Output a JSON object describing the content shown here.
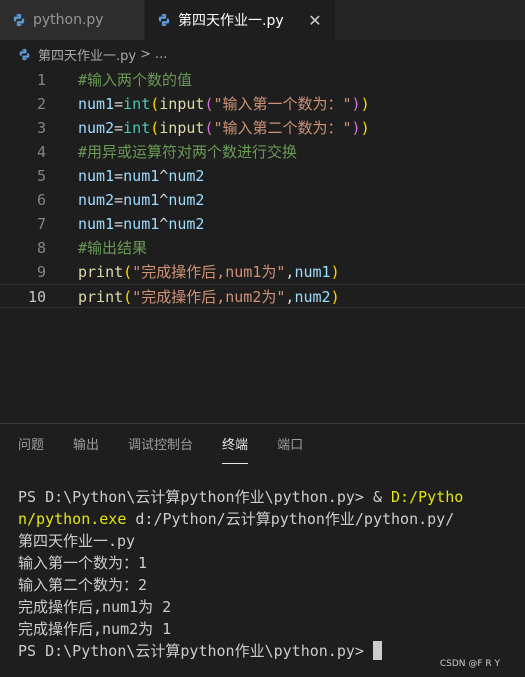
{
  "tabs": [
    {
      "label": "python.py",
      "active": false
    },
    {
      "label": "第四天作业一.py",
      "active": true
    }
  ],
  "close_icon_glyph": "✕",
  "breadcrumb": {
    "file": "第四天作业一.py",
    "sep": ">",
    "more": "..."
  },
  "editor": {
    "line_numbers": [
      "1",
      "2",
      "3",
      "4",
      "5",
      "6",
      "7",
      "8",
      "9",
      "10"
    ],
    "current_line": 10,
    "lines": [
      [
        {
          "t": "#输入两个数的值",
          "c": "cm"
        }
      ],
      [
        {
          "t": "num1",
          "c": "vr"
        },
        {
          "t": "=",
          "c": "op"
        },
        {
          "t": "int",
          "c": "ty"
        },
        {
          "t": "(",
          "c": "p1"
        },
        {
          "t": "input",
          "c": "fn"
        },
        {
          "t": "(",
          "c": "p2"
        },
        {
          "t": "\"输入第一个数为：\"",
          "c": "st"
        },
        {
          "t": ")",
          "c": "p2"
        },
        {
          "t": ")",
          "c": "p1"
        }
      ],
      [
        {
          "t": "num2",
          "c": "vr"
        },
        {
          "t": "=",
          "c": "op"
        },
        {
          "t": "int",
          "c": "ty"
        },
        {
          "t": "(",
          "c": "p1"
        },
        {
          "t": "input",
          "c": "fn"
        },
        {
          "t": "(",
          "c": "p2"
        },
        {
          "t": "\"输入第二个数为：\"",
          "c": "st"
        },
        {
          "t": ")",
          "c": "p2"
        },
        {
          "t": ")",
          "c": "p1"
        }
      ],
      [
        {
          "t": "#用异或运算符对两个数进行交换",
          "c": "cm"
        }
      ],
      [
        {
          "t": "num1",
          "c": "vr"
        },
        {
          "t": "=",
          "c": "op"
        },
        {
          "t": "num1",
          "c": "vr"
        },
        {
          "t": "^",
          "c": "op"
        },
        {
          "t": "num2",
          "c": "vr"
        }
      ],
      [
        {
          "t": "num2",
          "c": "vr"
        },
        {
          "t": "=",
          "c": "op"
        },
        {
          "t": "num1",
          "c": "vr"
        },
        {
          "t": "^",
          "c": "op"
        },
        {
          "t": "num2",
          "c": "vr"
        }
      ],
      [
        {
          "t": "num1",
          "c": "vr"
        },
        {
          "t": "=",
          "c": "op"
        },
        {
          "t": "num1",
          "c": "vr"
        },
        {
          "t": "^",
          "c": "op"
        },
        {
          "t": "num2",
          "c": "vr"
        }
      ],
      [
        {
          "t": "#输出结果",
          "c": "cm"
        }
      ],
      [
        {
          "t": "print",
          "c": "fn"
        },
        {
          "t": "(",
          "c": "p1"
        },
        {
          "t": "\"完成操作后,num1为\"",
          "c": "st"
        },
        {
          "t": ",",
          "c": "op"
        },
        {
          "t": "num1",
          "c": "vr"
        },
        {
          "t": ")",
          "c": "p1"
        }
      ],
      [
        {
          "t": "print",
          "c": "fn"
        },
        {
          "t": "(",
          "c": "p1"
        },
        {
          "t": "\"完成操作后,num2为\"",
          "c": "st"
        },
        {
          "t": ",",
          "c": "op"
        },
        {
          "t": "num2",
          "c": "vr"
        },
        {
          "t": ")",
          "c": "p1"
        }
      ]
    ]
  },
  "panel": {
    "tabs": [
      "问题",
      "输出",
      "调试控制台",
      "终端",
      "端口"
    ],
    "active_tab": "终端"
  },
  "terminal": {
    "cmd_prompt": "PS D:\\Python\\云计算python作业\\python.py> & ",
    "cmd_exe_part1": "D:/Pytho",
    "cmd_exe_part2": "n/python.exe",
    "cmd_rest": " d:/Python/云计算python作业/python.py/",
    "cmd_file": "第四天作业一.py",
    "output": [
      "输入第一个数为：1",
      "输入第二个数为：2",
      "完成操作后,num1为 2",
      "完成操作后,num2为 1"
    ],
    "final_prompt": "PS D:\\Python\\云计算python作业\\python.py> "
  },
  "watermark": "CSDN @F R Y",
  "colors": {
    "background": "#1e1e1e",
    "tabbar": "#252526",
    "python_icon_blue": "#3572a5",
    "python_icon_yellow": "#ffd43b"
  }
}
